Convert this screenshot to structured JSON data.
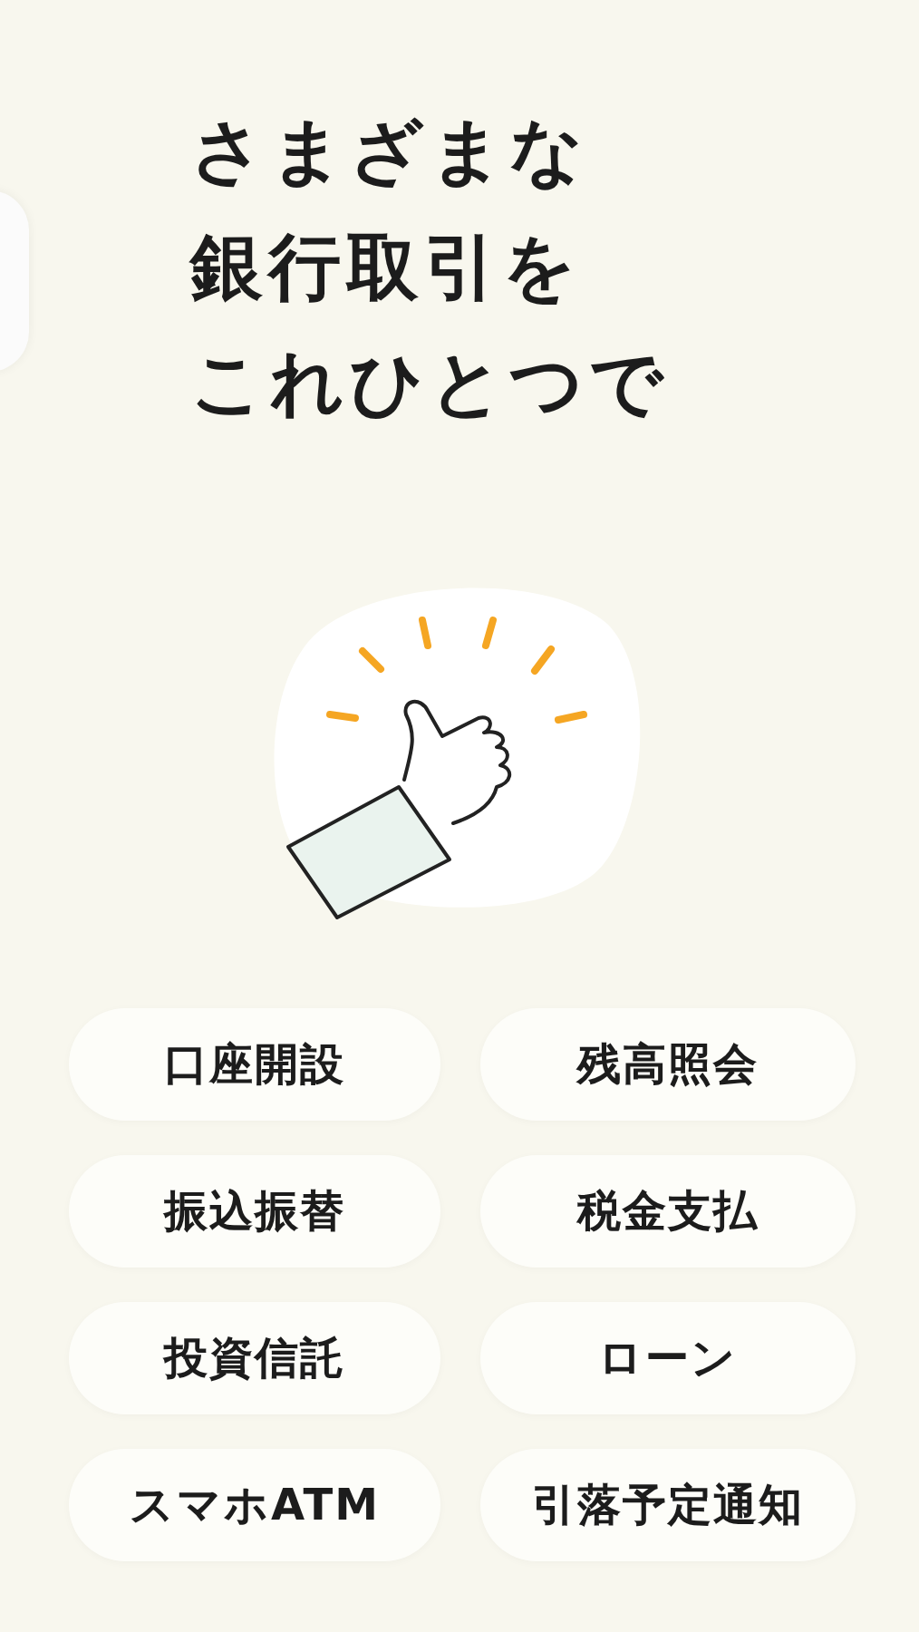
{
  "headline": [
    "さまざまな",
    "銀行取引を",
    "これひとつで"
  ],
  "features": [
    "口座開設",
    "残高照会",
    "振込振替",
    "税金支払",
    "投資信託",
    "ローン",
    "スマホATM",
    "引落予定通知"
  ]
}
